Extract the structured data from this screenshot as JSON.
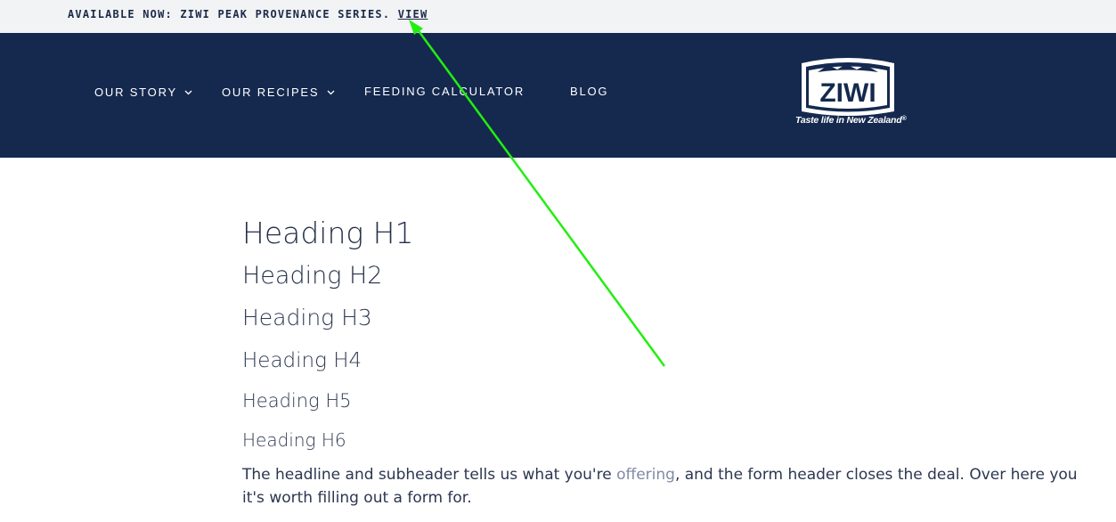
{
  "announcement": {
    "text": "AVAILABLE NOW: ZIWI PEAK PROVENANCE SERIES.",
    "link": "VIEW"
  },
  "nav": {
    "items": [
      {
        "label": "OUR STORY",
        "has_dropdown": true
      },
      {
        "label": "OUR RECIPES",
        "has_dropdown": true
      },
      {
        "label": "FEEDING CALCULATOR",
        "has_dropdown": false
      },
      {
        "label": "BLOG",
        "has_dropdown": false
      }
    ],
    "chevron": "⌄"
  },
  "logo": {
    "wordmark": "ZIWI",
    "tagline": "Taste life in New Zealand",
    "registered": "®"
  },
  "content": {
    "h1": "Heading H1",
    "h2": "Heading H2",
    "h3": "Heading H3",
    "h4": "Heading H4",
    "h5": "Heading H5",
    "h6": "Heading H6",
    "para_before": "The headline and subheader tells us what you're ",
    "para_link": "offering",
    "para_after": ", and the form header closes the deal. Over here you",
    "para_line2": "it's worth filling out a form for."
  },
  "colors": {
    "nav_bg": "#15294f",
    "announcement_bg": "#f2f3f5",
    "heading": "#243049",
    "link": "#7f8aa3",
    "annotation_arrow": "#22ee11"
  }
}
